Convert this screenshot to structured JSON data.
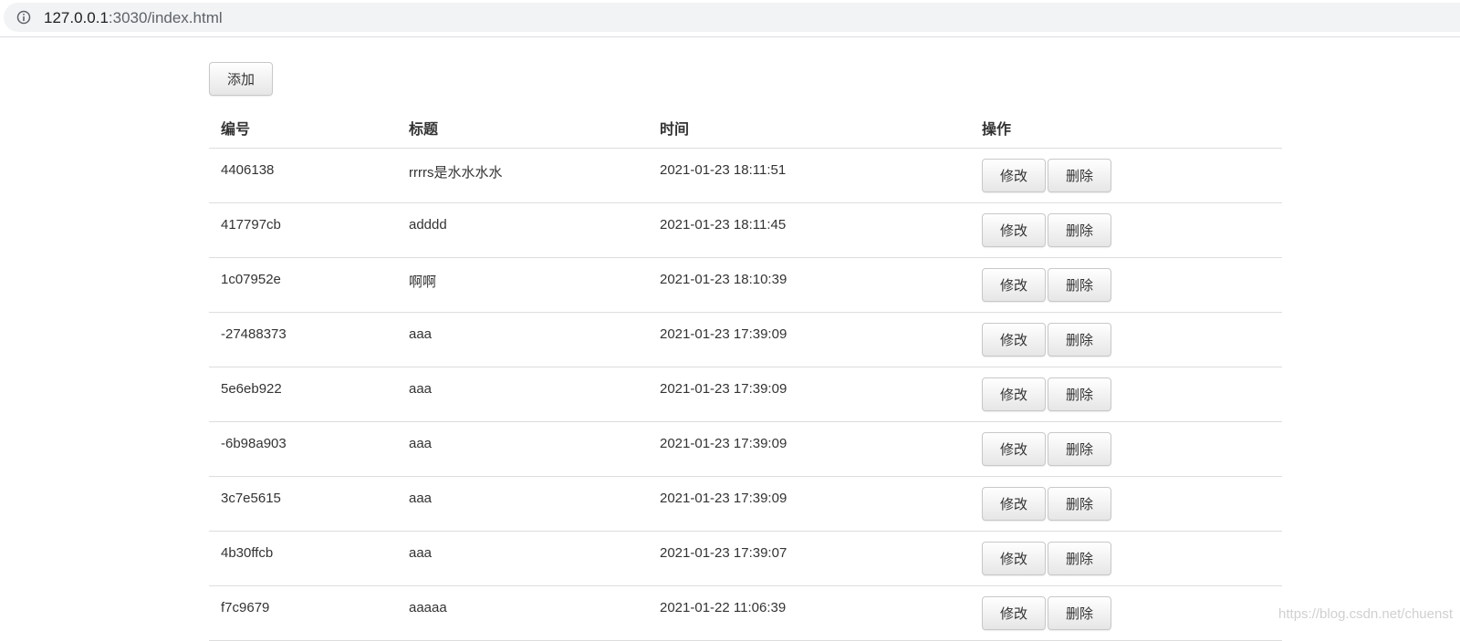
{
  "browser": {
    "url_host": "127.0.0.1",
    "url_rest": ":3030/index.html"
  },
  "toolbar": {
    "add_label": "添加"
  },
  "table": {
    "headers": [
      "编号",
      "标题",
      "时间",
      "操作"
    ],
    "edit_label": "修改",
    "delete_label": "删除",
    "rows": [
      {
        "id": "4406138",
        "title": "rrrrs是水水水水",
        "time": "2021-01-23 18:11:51"
      },
      {
        "id": "417797cb",
        "title": "adddd",
        "time": "2021-01-23 18:11:45"
      },
      {
        "id": "1c07952e",
        "title": "啊啊",
        "time": "2021-01-23 18:10:39"
      },
      {
        "id": "-27488373",
        "title": "aaa",
        "time": "2021-01-23 17:39:09"
      },
      {
        "id": "5e6eb922",
        "title": "aaa",
        "time": "2021-01-23 17:39:09"
      },
      {
        "id": "-6b98a903",
        "title": "aaa",
        "time": "2021-01-23 17:39:09"
      },
      {
        "id": "3c7e5615",
        "title": "aaa",
        "time": "2021-01-23 17:39:09"
      },
      {
        "id": "4b30ffcb",
        "title": "aaa",
        "time": "2021-01-23 17:39:07"
      },
      {
        "id": "f7c9679",
        "title": "aaaaa",
        "time": "2021-01-22 11:06:39"
      }
    ]
  },
  "watermark": "https://blog.csdn.net/chuenst"
}
